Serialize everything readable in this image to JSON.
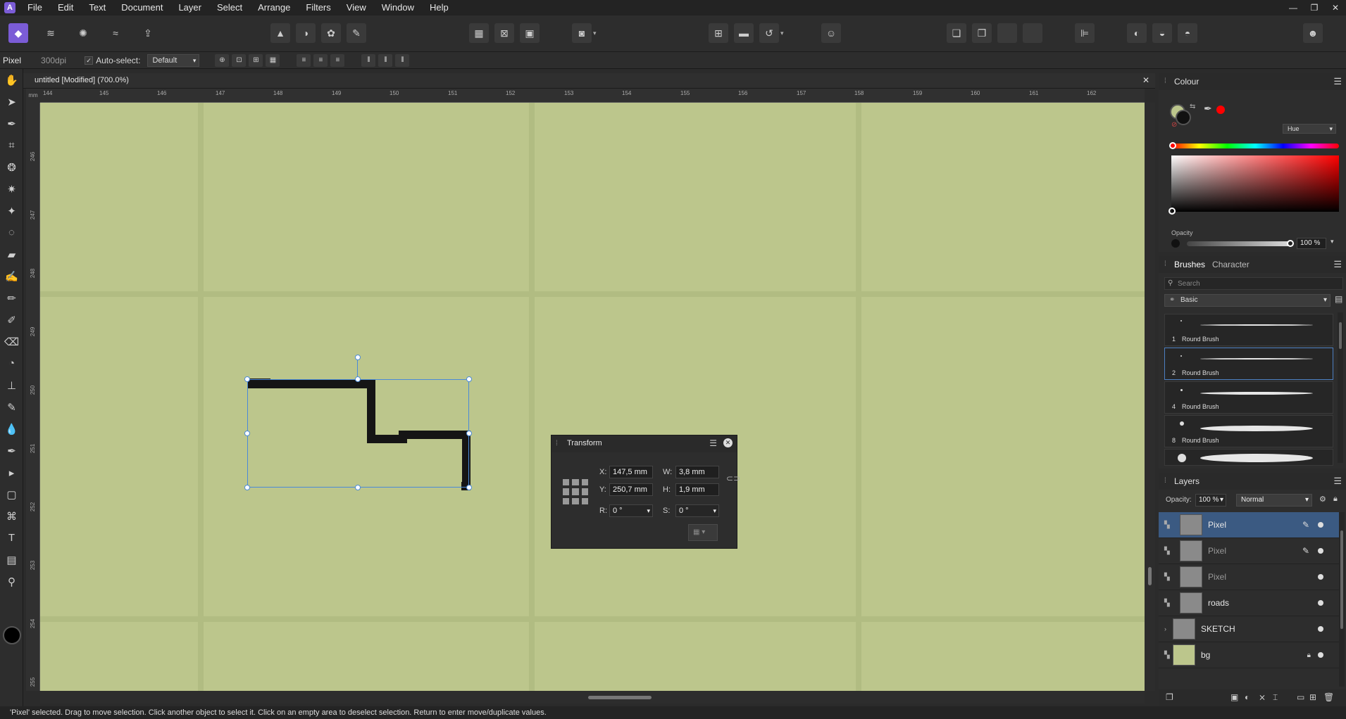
{
  "menubar": {
    "logo": "A",
    "items": [
      "File",
      "Edit",
      "Text",
      "Document",
      "Layer",
      "Select",
      "Arrange",
      "Filters",
      "View",
      "Window",
      "Help"
    ]
  },
  "context": {
    "persona": "Pixel",
    "dpi": "300dpi",
    "auto_select_label": "Auto-select:",
    "auto_select_value": "Default"
  },
  "document": {
    "tab_title": "untitled [Modified] (700.0%)",
    "ruler_h_labels": [
      "144",
      "145",
      "146",
      "147",
      "148",
      "149",
      "150",
      "151",
      "152",
      "153",
      "154",
      "155",
      "156",
      "157",
      "158",
      "159",
      "160",
      "161",
      "162"
    ],
    "ruler_v_labels": [
      "246",
      "247",
      "248",
      "249",
      "250",
      "251",
      "252",
      "253",
      "254",
      "255"
    ],
    "ruler_unit": "mm"
  },
  "transform": {
    "title": "Transform",
    "x_label": "X:",
    "x_value": "147,5 mm",
    "y_label": "Y:",
    "y_value": "250,7 mm",
    "w_label": "W:",
    "w_value": "3,8 mm",
    "h_label": "H:",
    "h_value": "1,9 mm",
    "r_label": "R:",
    "r_value": "0 °",
    "s_label": "S:",
    "s_value": "0 °"
  },
  "colour": {
    "title": "Colour",
    "mode": "Hue",
    "opacity_label": "Opacity",
    "opacity_value": "100 %",
    "accent": "#ff0000"
  },
  "brushes": {
    "tab_brushes": "Brushes",
    "tab_character": "Character",
    "search_placeholder": "Search",
    "category": "Basic",
    "items": [
      {
        "num": "1",
        "label": "Round Brush"
      },
      {
        "num": "2",
        "label": "Round Brush"
      },
      {
        "num": "4",
        "label": "Round Brush"
      },
      {
        "num": "8",
        "label": "Round Brush"
      }
    ]
  },
  "layers": {
    "title": "Layers",
    "opacity_label": "Opacity:",
    "opacity_value": "100 %",
    "blend_mode": "Normal",
    "items": [
      {
        "name": "Pixel"
      },
      {
        "name": "Pixel"
      },
      {
        "name": "Pixel"
      },
      {
        "name": "roads"
      },
      {
        "name": "SKETCH"
      },
      {
        "name": "bg"
      }
    ]
  },
  "status": {
    "text": "'Pixel' selected. Drag to move selection. Click another object to select it. Click on an empty area to deselect selection. Return to enter move/duplicate values."
  }
}
